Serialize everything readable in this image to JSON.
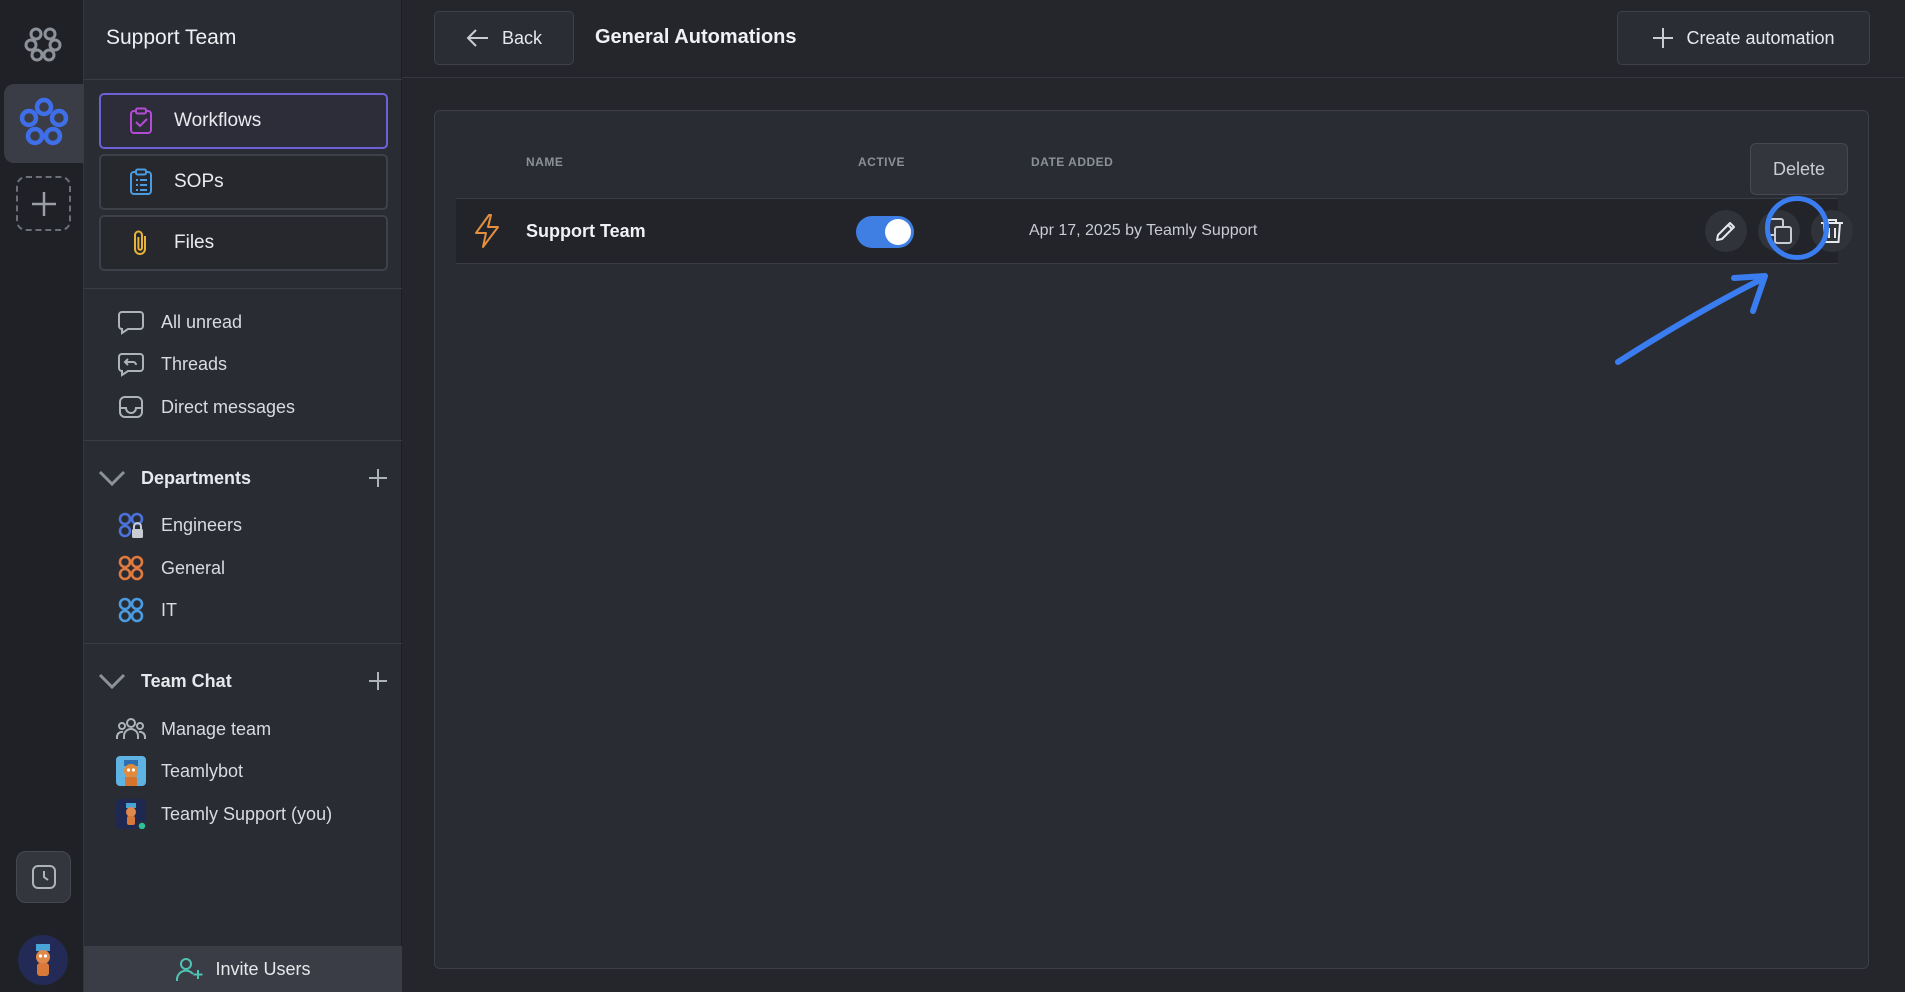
{
  "sidebar": {
    "title": "Support Team",
    "nav": [
      {
        "label": "Workflows"
      },
      {
        "label": "SOPs"
      },
      {
        "label": "Files"
      }
    ],
    "general": [
      {
        "label": "All unread"
      },
      {
        "label": "Threads"
      },
      {
        "label": "Direct messages"
      }
    ],
    "departments": {
      "title": "Departments",
      "items": [
        {
          "label": "Engineers",
          "color": "#4b72d9"
        },
        {
          "label": "General",
          "color": "#e17a3f"
        },
        {
          "label": "IT",
          "color": "#4a9be0"
        }
      ]
    },
    "team_chat": {
      "title": "Team Chat",
      "items": [
        {
          "label": "Manage team"
        },
        {
          "label": "Teamlybot"
        },
        {
          "label": "Teamly Support (you)"
        }
      ]
    },
    "invite_label": "Invite Users"
  },
  "header": {
    "back_label": "Back",
    "title": "General Automations",
    "create_label": "Create automation"
  },
  "table": {
    "columns": [
      "NAME",
      "ACTIVE",
      "DATE ADDED"
    ],
    "rows": [
      {
        "name": "Support Team",
        "active": true,
        "date_added": "Apr 17, 2025 by Teamly Support"
      }
    ],
    "tooltip": "Delete"
  },
  "colors": {
    "accent": "#3f7fe3",
    "workflow_active_border": "#6d5fd6",
    "highlight": "#3a7df0"
  }
}
